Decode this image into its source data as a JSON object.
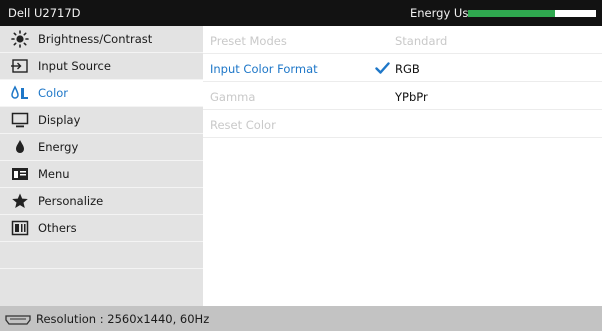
{
  "header": {
    "title": "Dell U2717D",
    "energy_label": "Energy Use",
    "energy_level": 0.68,
    "colors": {
      "bar_fill": "#2fa84f",
      "background": "#121212"
    }
  },
  "sidebar": {
    "items": [
      {
        "label": "Brightness/Contrast",
        "icon": "brightness-icon"
      },
      {
        "label": "Input Source",
        "icon": "input-source-icon"
      },
      {
        "label": "Color",
        "icon": "color-icon",
        "selected": true
      },
      {
        "label": "Display",
        "icon": "display-icon"
      },
      {
        "label": "Energy",
        "icon": "energy-icon"
      },
      {
        "label": "Menu",
        "icon": "menu-icon"
      },
      {
        "label": "Personalize",
        "icon": "star-icon"
      },
      {
        "label": "Others",
        "icon": "others-icon"
      }
    ]
  },
  "content": {
    "rows": [
      {
        "name": "Preset Modes",
        "value": "Standard"
      },
      {
        "name": "Input Color Format",
        "value": "RGB",
        "checked": true
      },
      {
        "name": "Gamma",
        "value": "YPbPr"
      },
      {
        "name": "Reset Color",
        "value": ""
      }
    ]
  },
  "footer": {
    "text": "Resolution : 2560x1440, 60Hz",
    "icon": "hdmi-port-icon"
  },
  "colors": {
    "accent_blue": "#1e77c8",
    "sidebar_bg": "#e3e3e3",
    "footer_bg": "#c3c3c3",
    "disabled_text": "#c9c9c9"
  }
}
